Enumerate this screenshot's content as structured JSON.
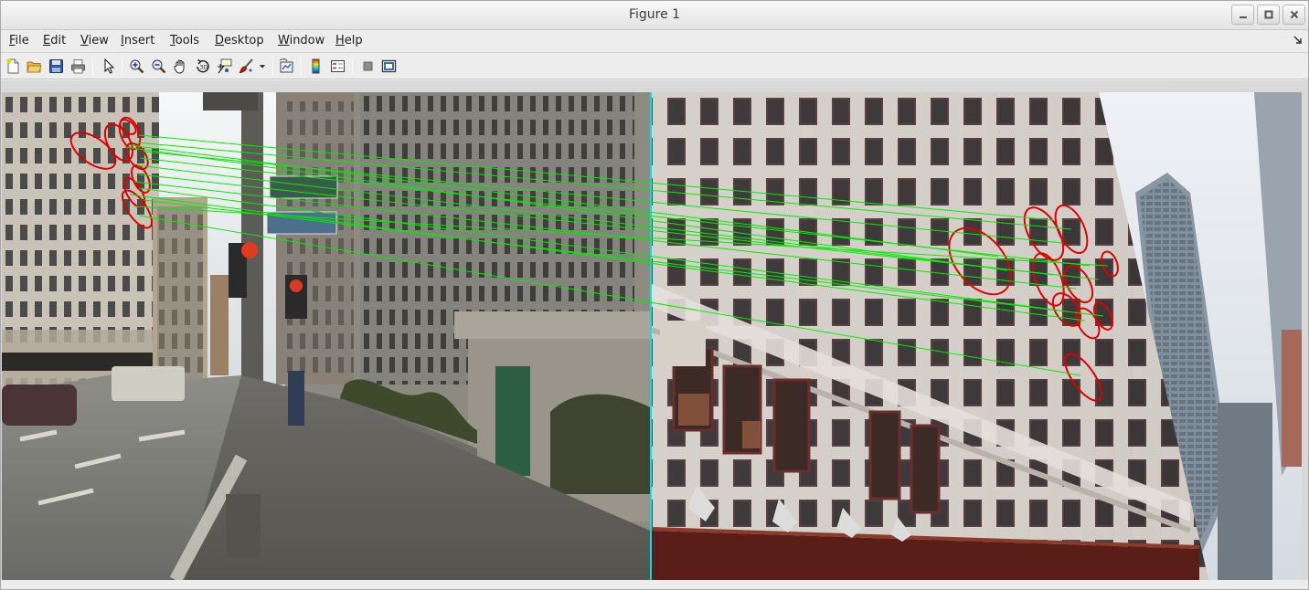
{
  "window": {
    "title": "Figure 1",
    "controls": [
      "minimize-icon",
      "maximize-icon",
      "close-icon"
    ]
  },
  "menubar": {
    "items": [
      {
        "label": "File",
        "mnemonic": "F"
      },
      {
        "label": "Edit",
        "mnemonic": "E"
      },
      {
        "label": "View",
        "mnemonic": "V"
      },
      {
        "label": "Insert",
        "mnemonic": "I"
      },
      {
        "label": "Tools",
        "mnemonic": "T"
      },
      {
        "label": "Desktop",
        "mnemonic": "D"
      },
      {
        "label": "Window",
        "mnemonic": "W"
      },
      {
        "label": "Help",
        "mnemonic": "H"
      }
    ]
  },
  "toolbar": {
    "tools": [
      "new-figure-icon",
      "open-file-icon",
      "save-icon",
      "print-icon",
      "edit-plot-icon",
      "zoom-in-icon",
      "zoom-out-icon",
      "pan-icon",
      "rotate-3d-icon",
      "data-cursor-icon",
      "brush-icon",
      "brush-dropdown-icon",
      "link-plot-icon",
      "colorbar-icon",
      "legend-icon",
      "hide-plot-tools-icon",
      "show-plot-tools-icon"
    ]
  },
  "figure": {
    "divider_color": "#00e5e5",
    "match_line_color": "#00ee00",
    "ellipse_color": "#e00000",
    "match_count": 14
  }
}
